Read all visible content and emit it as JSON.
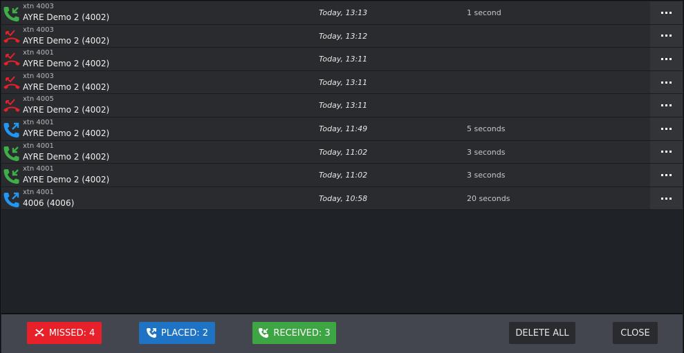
{
  "colors": {
    "missed": "#e8202a",
    "placed": "#1f73c4",
    "received": "#3da544",
    "icon_received": "#3fae49",
    "icon_missed": "#e8202a",
    "icon_placed": "#2196f3"
  },
  "calls": [
    {
      "type": "received",
      "icon": "phone-received-icon",
      "extension": "xtn 4003",
      "contact": "AYRE Demo 2 (4002)",
      "time": "Today, 13:13",
      "duration": "1 second"
    },
    {
      "type": "missed",
      "icon": "phone-missed-icon",
      "extension": "xtn 4003",
      "contact": "AYRE Demo 2 (4002)",
      "time": "Today, 13:12",
      "duration": ""
    },
    {
      "type": "missed",
      "icon": "phone-missed-icon",
      "extension": "xtn 4001",
      "contact": "AYRE Demo 2 (4002)",
      "time": "Today, 13:11",
      "duration": ""
    },
    {
      "type": "missed",
      "icon": "phone-missed-icon",
      "extension": "xtn 4003",
      "contact": "AYRE Demo 2 (4002)",
      "time": "Today, 13:11",
      "duration": ""
    },
    {
      "type": "missed",
      "icon": "phone-missed-icon",
      "extension": "xtn 4005",
      "contact": "AYRE Demo 2 (4002)",
      "time": "Today, 13:11",
      "duration": ""
    },
    {
      "type": "placed",
      "icon": "phone-placed-icon",
      "extension": "xtn 4001",
      "contact": "AYRE Demo 2 (4002)",
      "time": "Today, 11:49",
      "duration": "5 seconds"
    },
    {
      "type": "received",
      "icon": "phone-received-icon",
      "extension": "xtn 4001",
      "contact": "AYRE Demo 2 (4002)",
      "time": "Today, 11:02",
      "duration": "3 seconds"
    },
    {
      "type": "received",
      "icon": "phone-received-icon",
      "extension": "xtn 4001",
      "contact": "AYRE Demo 2 (4002)",
      "time": "Today, 11:02",
      "duration": "3 seconds"
    },
    {
      "type": "placed",
      "icon": "phone-placed-icon",
      "extension": "xtn 4001",
      "contact": "4006 (4006)",
      "time": "Today, 10:58",
      "duration": "20 seconds"
    }
  ],
  "row_action_icon": "more-options-icon",
  "footer": {
    "missed_label": "MISSED: 4",
    "placed_label": "PLACED: 2",
    "received_label": "RECEIVED: 3",
    "delete_all_label": "DELETE ALL",
    "close_label": "CLOSE"
  }
}
